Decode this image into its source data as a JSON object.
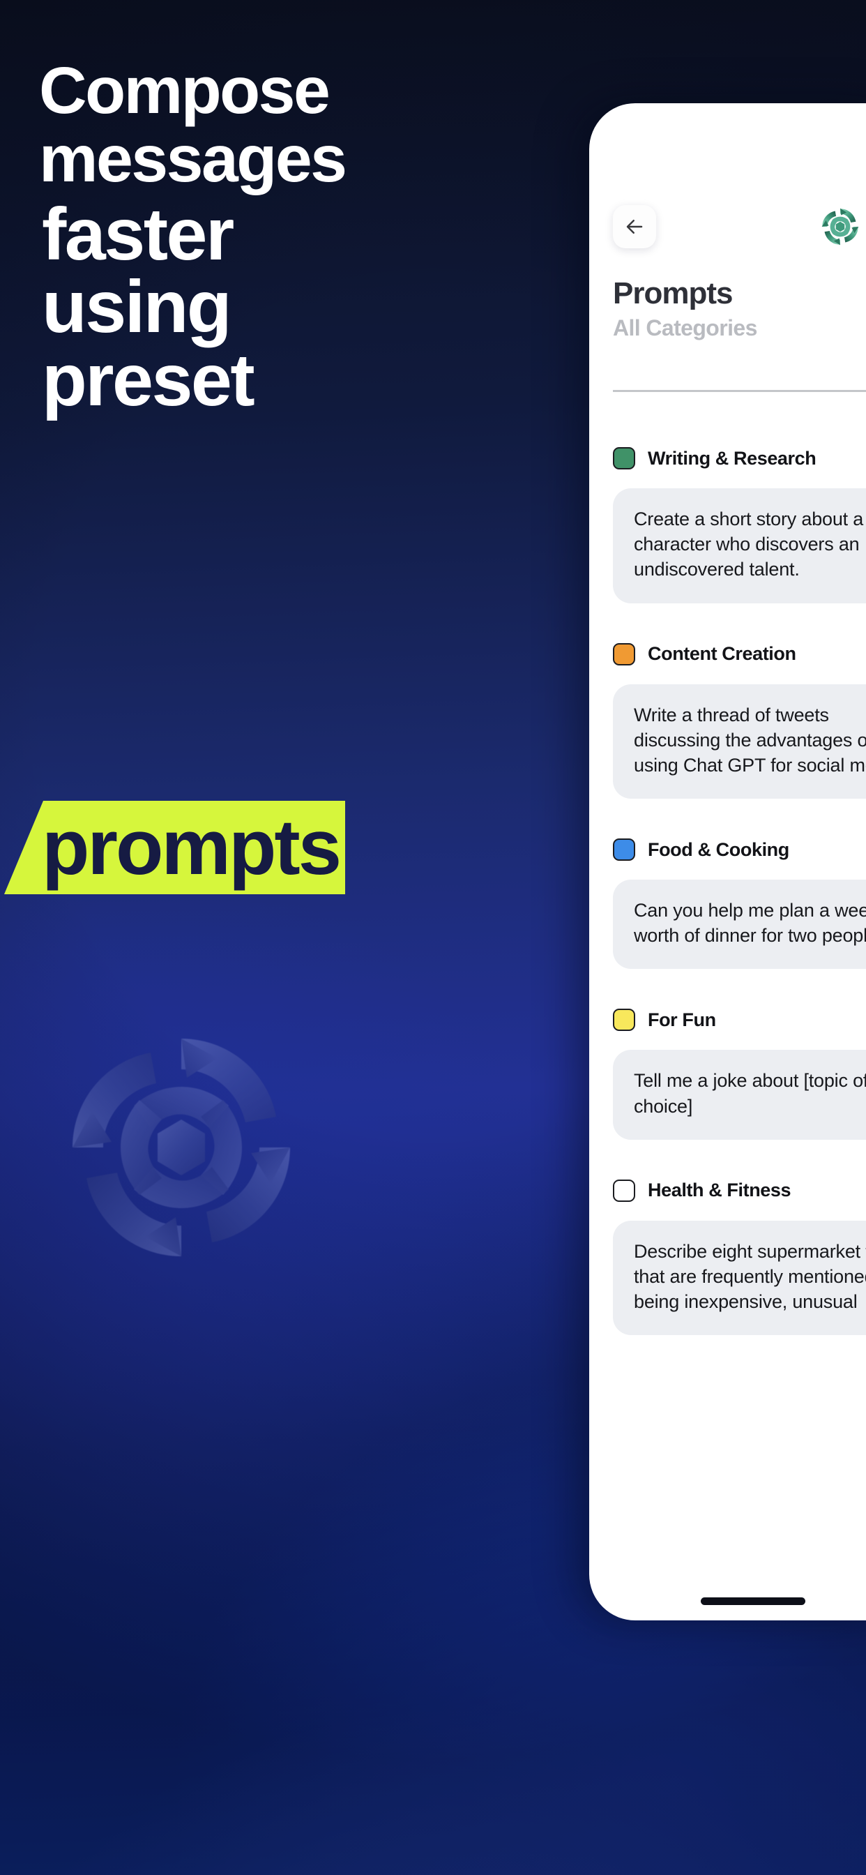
{
  "headline": {
    "lines": [
      "Compose",
      "messages",
      "faster",
      "using",
      "preset"
    ],
    "highlight_word": "prompts",
    "highlight_bg": "#d6f63c",
    "highlight_text_color": "#161b43",
    "text_color": "#ffffff"
  },
  "background": {
    "top_color": "#0b1020",
    "mid_color": "#223094",
    "bottom_color": "#123bb5"
  },
  "watermark": {
    "name": "brand-logo-watermark"
  },
  "phone": {
    "header": {
      "back_icon": "arrow-left-icon",
      "app_icon": "app-logo-icon",
      "app_icon_color": "#4ea287"
    },
    "title": "Prompts",
    "subtitle": "All Categories",
    "search_icon": "search-circle-icon",
    "categories": [
      {
        "label": "Writing & Research",
        "color": "#409268",
        "prompt": "Create a short story about a character who discovers an undiscovered talent."
      },
      {
        "label": "Content Creation",
        "color": "#f09a33",
        "prompt": "Write a thread of tweets discussing the advantages of using Chat GPT for social media"
      },
      {
        "label": "Food & Cooking",
        "color": "#3d8ce8",
        "prompt": "Can you help me plan a week's worth of dinner for two people"
      },
      {
        "label": "For Fun",
        "color": "#f8e85c",
        "prompt": "Tell me a joke about [topic of choice]"
      },
      {
        "label": "Health & Fitness",
        "color": "#ffffff",
        "prompt": "Describe eight supermarket foods that are frequently mentioned as being inexpensive, unusual"
      }
    ]
  }
}
